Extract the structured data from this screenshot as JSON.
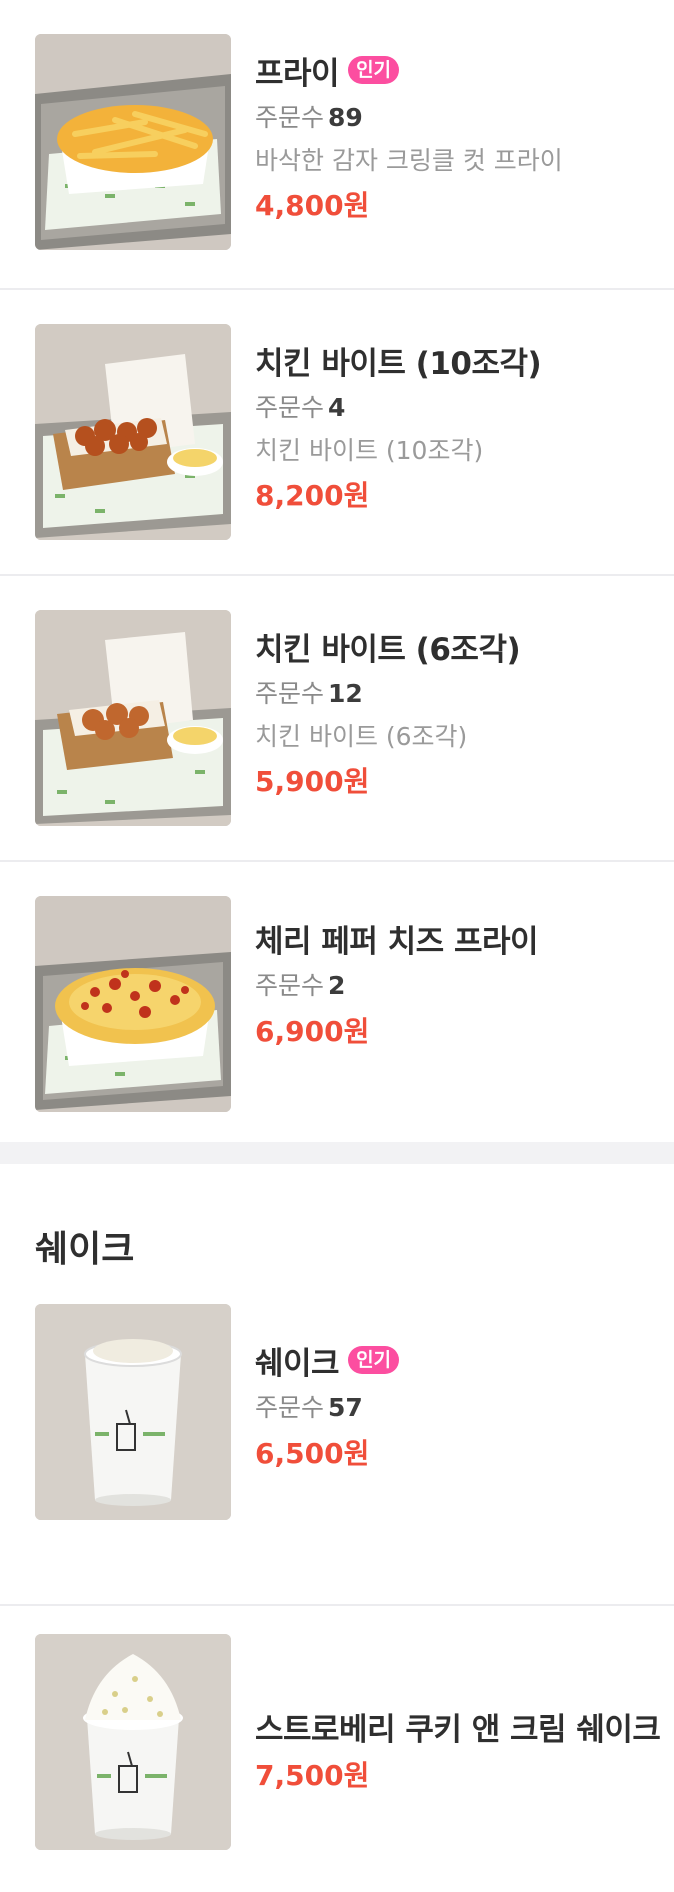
{
  "badge_label": "인기",
  "order_label": "주문수",
  "fries_section": {
    "items": [
      {
        "name": "프라이",
        "badge": true,
        "orders": "89",
        "description": "바삭한 감자 크링클 컷 프라이",
        "price": "4,800원"
      },
      {
        "name": "치킨 바이트 (10조각)",
        "badge": false,
        "orders": "4",
        "description": "치킨 바이트 (10조각)",
        "price": "8,200원"
      },
      {
        "name": "치킨 바이트 (6조각)",
        "badge": false,
        "orders": "12",
        "description": "치킨 바이트 (6조각)",
        "price": "5,900원"
      },
      {
        "name": "체리 페퍼 치즈 프라이",
        "badge": false,
        "orders": "2",
        "price": "6,900원"
      }
    ]
  },
  "shake_section": {
    "title": "쉐이크",
    "items": [
      {
        "name": "쉐이크",
        "badge": true,
        "orders": "57",
        "price": "6,500원"
      },
      {
        "name": "스트로베리 쿠키 앤 크림 쉐이크",
        "price": "7,500원"
      }
    ]
  }
}
